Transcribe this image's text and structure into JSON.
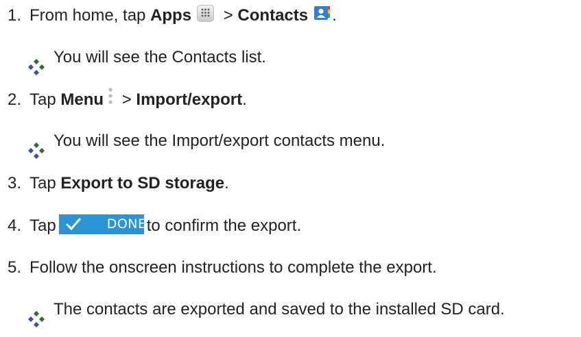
{
  "steps": [
    {
      "number": "1.",
      "pre": "From home, tap ",
      "apps_label": "Apps",
      "sep": " > ",
      "contacts_label": "Contacts",
      "post": "."
    },
    {
      "number": "2.",
      "pre": "Tap ",
      "menu_label": "Menu",
      "sep": " > ",
      "import_label": "Import/export",
      "post": "."
    },
    {
      "number": "3.",
      "pre": "Tap ",
      "export_label": "Export to SD storage",
      "post": "."
    },
    {
      "number": "4.",
      "pre": "Tap",
      "button_label": "DONE",
      "post": "to confirm the export."
    },
    {
      "number": "5.",
      "text": "Follow the onscreen instructions to complete the export."
    }
  ],
  "results": [
    "You will see the Contacts list.",
    "You will see the Import/export contacts menu.",
    "The contacts are exported and saved to the installed SD card."
  ],
  "icons": {
    "apps": "apps-grid-icon",
    "contacts": "contacts-app-icon",
    "menu": "overflow-menu-icon",
    "bullet": "diamond-bullet-icon",
    "check": "check-icon"
  },
  "colors": {
    "done_button": "#2a95d6",
    "text": "#222222"
  }
}
